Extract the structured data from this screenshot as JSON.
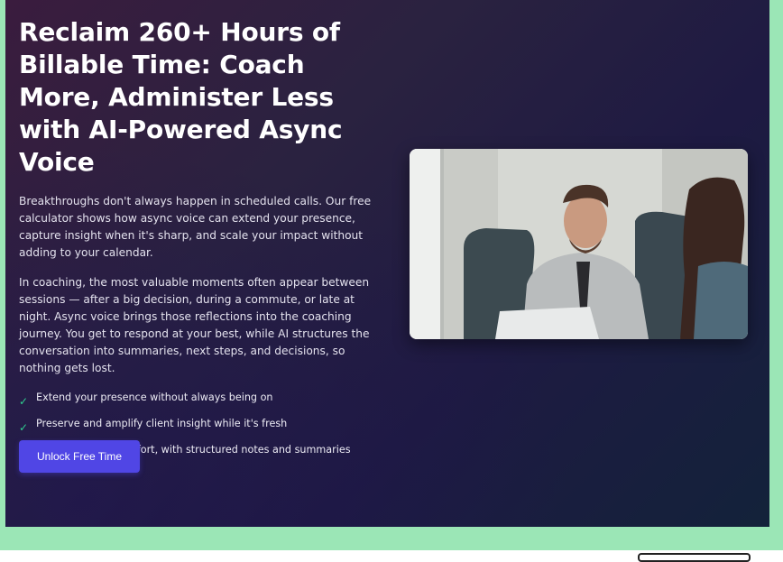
{
  "hero": {
    "title": "Reclaim 260+ Hours of Billable Time: Coach More, Administer Less with AI-Powered Async Voice",
    "paragraphs": [
      "Breakthroughs don't always happen in scheduled calls. Our free calculator shows how async voice can extend your presence, capture insight when it's sharp, and scale your impact without adding to your calendar.",
      "In coaching, the most valuable moments often appear between sessions — after a big decision, during a commute, or late at night. Async voice brings those reflections into the coaching journey. You get to respond at your best, while AI structures the conversation into summaries, next steps, and decisions, so nothing gets lost."
    ],
    "benefits": [
      "Extend your presence without always being on",
      "Preserve and amplify client insight while it's fresh",
      "Scale impact, not effort, with structured notes and summaries"
    ],
    "check_icon": "✓",
    "cta_label": "Unlock Free Time"
  },
  "colors": {
    "accent": "#5046e5",
    "check": "#2fd08f",
    "frame": "#9be6b6"
  }
}
